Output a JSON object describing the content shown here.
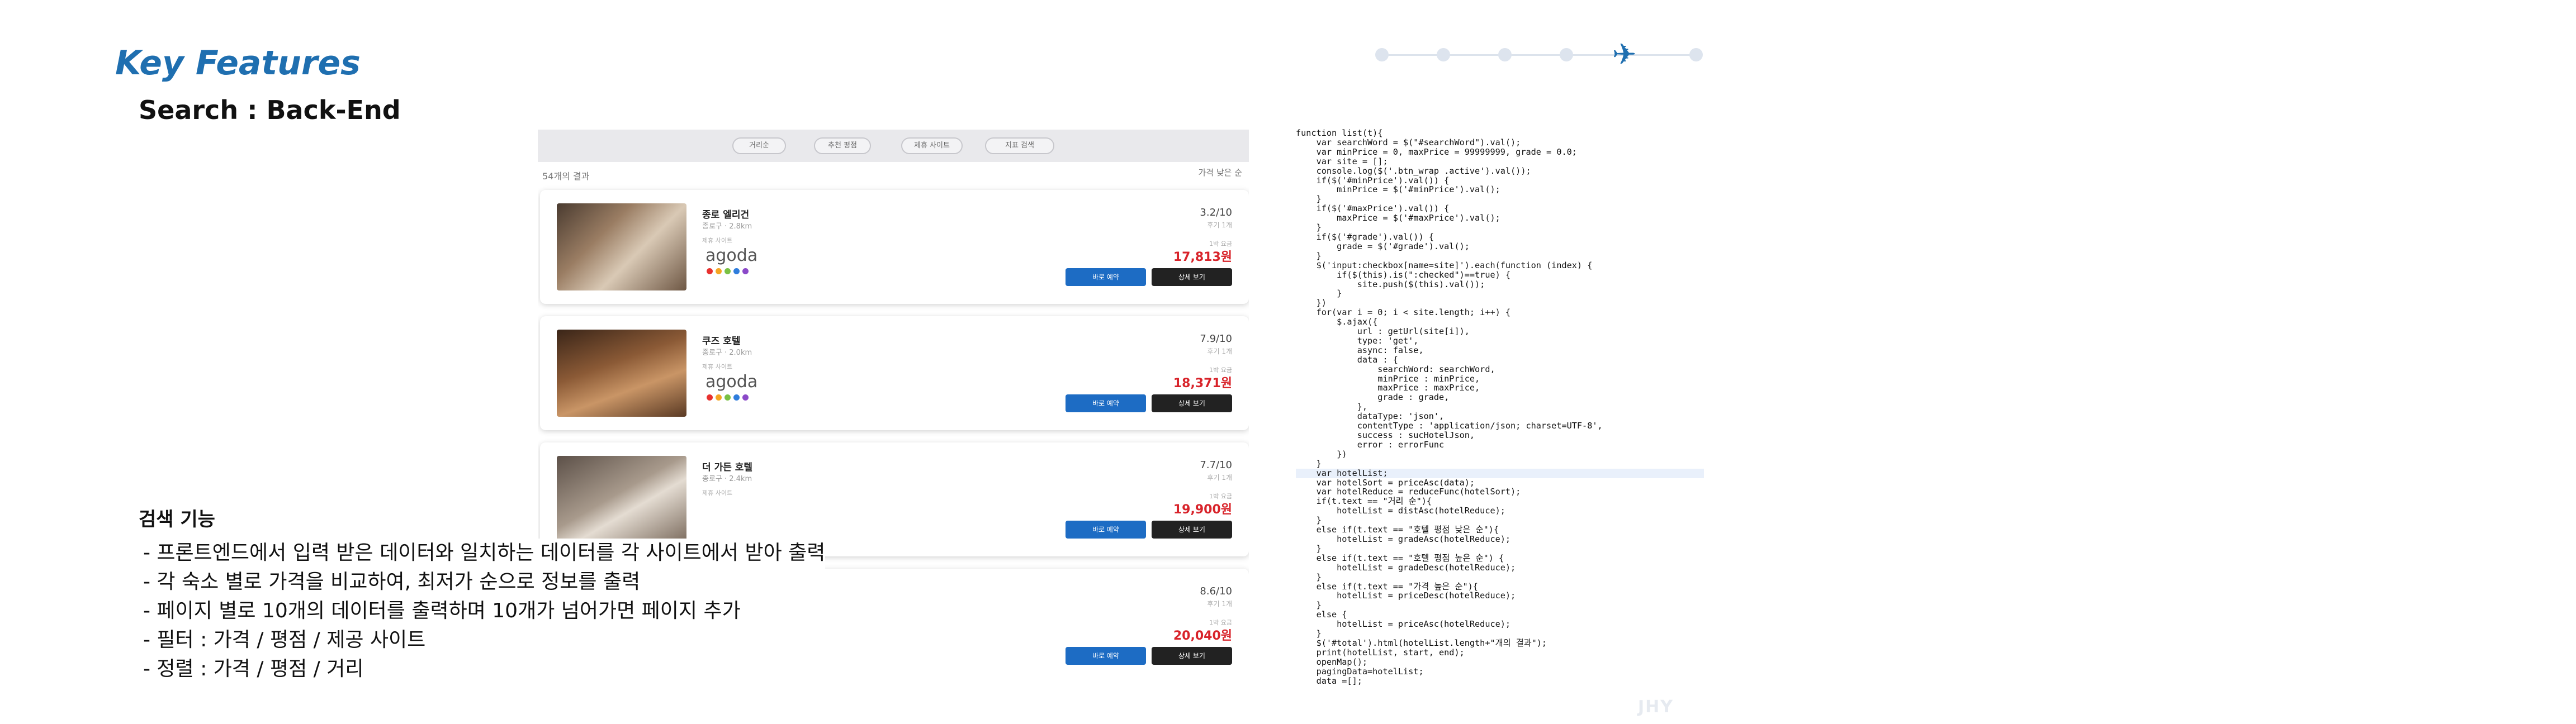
{
  "slide": {
    "title": "Key Features",
    "subtitle": "Search : Back-End"
  },
  "progress": {
    "steps": 6,
    "current": 5,
    "icon": "airplane-icon",
    "accent": "#1f6fb0"
  },
  "screenshot": {
    "filters": [
      "거리순",
      "추천 평점",
      "제휴 사이트",
      "지표 검색"
    ],
    "result_count": "54개의 결과",
    "sort_label": "가격 낮은 순",
    "cards": [
      {
        "name": "종로 엘리건",
        "distance": "종로구 · 2.8km",
        "site_caption": "제휴 사이트",
        "site": "agoda",
        "rating": "3.2/10",
        "reviews": "후기 1개",
        "price_caption": "1박 요금",
        "price": "17,813원",
        "book": "바로 예약",
        "detail": "상세 보기"
      },
      {
        "name": "쿠즈 호텔",
        "distance": "종로구 · 2.0km",
        "site_caption": "제휴 사이트",
        "site": "agoda",
        "rating": "7.9/10",
        "reviews": "후기 1개",
        "price_caption": "1박 요금",
        "price": "18,371원",
        "book": "바로 예약",
        "detail": "상세 보기"
      },
      {
        "name": "더 가든 호텔",
        "distance": "종로구 · 2.4km",
        "site_caption": "제휴 사이트",
        "site": "",
        "rating": "7.7/10",
        "reviews": "후기 1개",
        "price_caption": "1박 요금",
        "price": "19,900원",
        "book": "바로 예약",
        "detail": "상세 보기"
      },
      {
        "name": "",
        "distance": "",
        "site_caption": "",
        "site": "",
        "rating": "8.6/10",
        "reviews": "후기 1개",
        "price_caption": "1박 요금",
        "price": "20,040원",
        "book": "바로 예약",
        "detail": "상세 보기"
      }
    ],
    "brand_dot_colors": [
      "#e8312f",
      "#f5a623",
      "#7ac143",
      "#2f7ddc",
      "#8b49c8"
    ]
  },
  "features": {
    "title": "검색 기능",
    "items": [
      "- 프론트엔드에서 입력 받은 데이터와 일치하는 데이터를 각 사이트에서 받아 출력",
      "- 각 숙소 별로 가격을 비교하여, 최저가 순으로 정보를 출력",
      "- 페이지 별로 10개의 데이터를 출력하며 10개가 넘어가면 페이지 추가",
      "- 필터 : 가격 / 평점 / 제공 사이트",
      "- 정렬 : 가격 / 평점 / 거리"
    ]
  },
  "code": {
    "lines": [
      "function list(t){",
      "    var searchWord = $(\"#searchWord\").val();",
      "    var minPrice = 0, maxPrice = 99999999, grade = 0.0;",
      "    var site = [];",
      "    console.log($('.btn_wrap .active').val());",
      "    if($('#minPrice').val()) {",
      "        minPrice = $('#minPrice').val();",
      "    }",
      "    if($('#maxPrice').val()) {",
      "        maxPrice = $('#maxPrice').val();",
      "    }",
      "    if($('#grade').val()) {",
      "        grade = $('#grade').val();",
      "    }",
      "    $('input:checkbox[name=site]').each(function (index) {",
      "        if($(this).is(\":checked\")==true) {",
      "            site.push($(this).val());",
      "        }",
      "    })",
      "    for(var i = 0; i < site.length; i++) {",
      "        $.ajax({",
      "            url : getUrl(site[i]),",
      "            type: 'get',",
      "            async: false,",
      "            data : {",
      "                searchWord: searchWord,",
      "                minPrice : minPrice,",
      "                maxPrice : maxPrice,",
      "                grade : grade,",
      "            },",
      "            dataType: 'json',",
      "            contentType : 'application/json; charset=UTF-8',",
      "            success : sucHotelJson,",
      "            error : errorFunc",
      "        })",
      "    }",
      "    var hotelList;",
      "    var hotelSort = priceAsc(data);",
      "    var hotelReduce = reduceFunc(hotelSort);",
      "    if(t.text == \"거리 순\"){",
      "        hotelList = distAsc(hotelReduce);",
      "    }",
      "    else if(t.text == \"호텔 평점 낮은 순\"){",
      "        hotelList = gradeAsc(hotelReduce);",
      "    }",
      "    else if(t.text == \"호텔 평점 높은 순\") {",
      "        hotelList = gradeDesc(hotelReduce);",
      "    }",
      "    else if(t.text == \"가격 높은 순\"){",
      "        hotelList = priceDesc(hotelReduce);",
      "    }",
      "    else {",
      "        hotelList = priceAsc(hotelReduce);",
      "    }",
      "    $('#total').html(hotelList.length+\"개의 결과\");",
      "    print(hotelList, start, end);",
      "    openMap();",
      "    pagingData=hotelList;",
      "    data =[];"
    ],
    "highlight_line": 36
  },
  "watermark": "JHY"
}
